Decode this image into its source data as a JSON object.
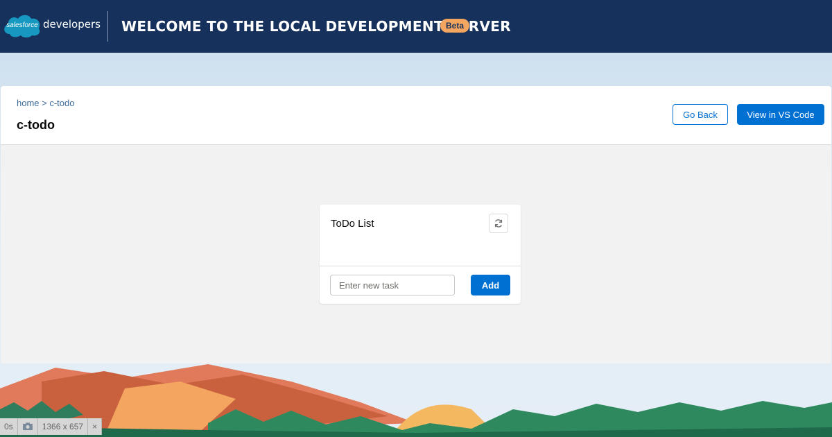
{
  "header": {
    "logo_cloud_text": "salesforce",
    "logo_word": "developers",
    "welcome": "Welcome to the Local Development Server",
    "beta_badge": "Beta"
  },
  "page": {
    "breadcrumb": "home > c-todo",
    "title": "c-todo",
    "go_back_label": "Go Back",
    "vscode_label": "View in VS Code"
  },
  "todo_card": {
    "title": "ToDo List",
    "input_placeholder": "Enter new task",
    "add_label": "Add"
  },
  "devbar": {
    "time": "0s",
    "dimensions": "1366 x 657",
    "close": "×"
  },
  "colors": {
    "header_bg": "#16325c",
    "brand_blue": "#0070d2",
    "beta_orange": "#f4a55f"
  }
}
